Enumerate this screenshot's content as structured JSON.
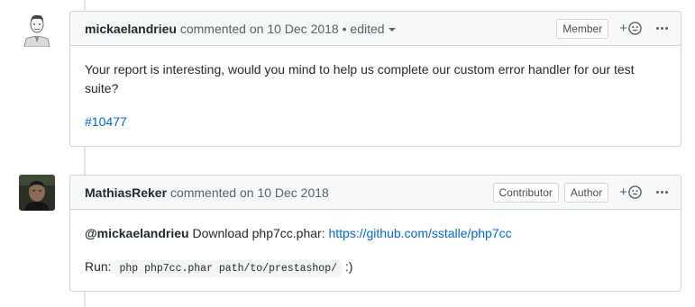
{
  "comments": [
    {
      "author": "mickaelandrieu",
      "commented_text": "commented on",
      "date": "10 Dec 2018",
      "separator": "•",
      "edited_label": "edited",
      "badges": [
        "Member"
      ],
      "body_line1": "Your report is interesting, would you mind to help us complete our custom error handler for our test suite?",
      "issue_link": "#10477"
    },
    {
      "author": "MathiasReker",
      "commented_text": "commented on",
      "date": "10 Dec 2018",
      "badges": [
        "Contributor",
        "Author"
      ],
      "mention": "@mickaelandrieu",
      "body_text": "Download php7cc.phar:",
      "link": "https://github.com/sstalle/php7cc",
      "run_label": "Run:",
      "run_code": "php php7cc.phar path/to/prestashop/",
      "run_suffix": ":)"
    }
  ],
  "reaction_plus": "+",
  "colors": {
    "link": "#0366d6",
    "header_bg": "#f6f8fa",
    "border": "#d1d5da"
  }
}
